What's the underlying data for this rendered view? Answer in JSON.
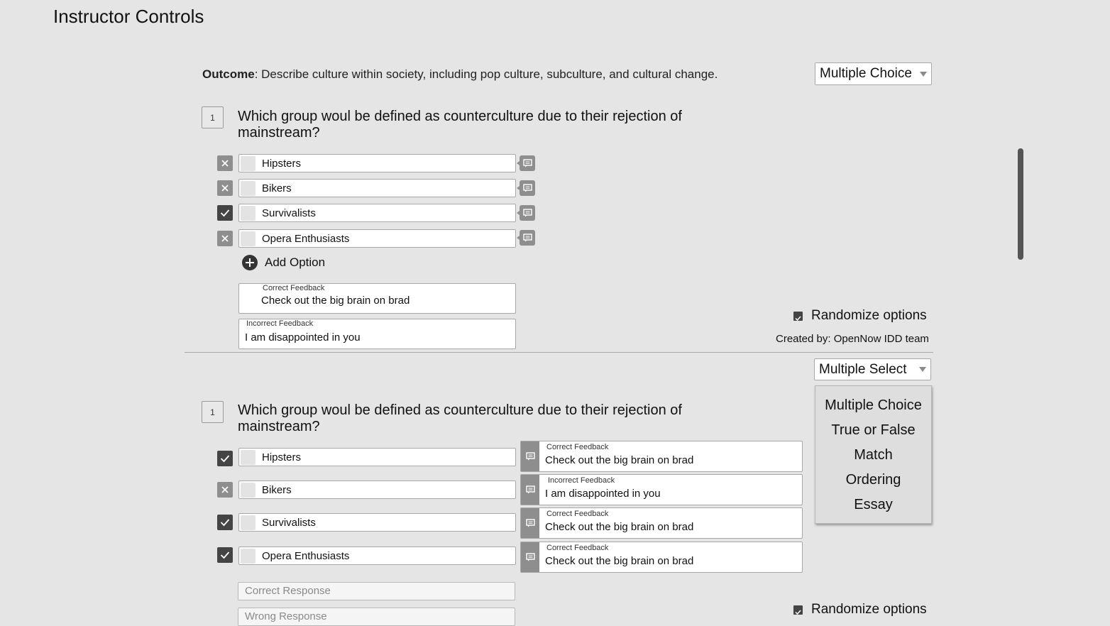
{
  "page": {
    "title": "Instructor Controls"
  },
  "outcome": {
    "label": "Outcome",
    "text": ": Describe culture within society, including pop culture, subculture, and cultural change."
  },
  "question1": {
    "type_select": "Multiple Choice",
    "number": "1",
    "text": "Which group woul be defined as counterculture due to their rejection of mainstream?",
    "options": [
      {
        "label": "Hipsters",
        "correct": false
      },
      {
        "label": "Bikers",
        "correct": false
      },
      {
        "label": "Survivalists",
        "correct": true
      },
      {
        "label": "Opera Enthusiasts",
        "correct": false
      }
    ],
    "add_option_label": "Add Option",
    "correct_feedback": {
      "label": "Correct Feedback",
      "value": "Check out the big brain on brad"
    },
    "incorrect_feedback": {
      "label": "Incorrect Feedback",
      "value": "I am disappointed in you"
    },
    "randomize_label": "Randomize options",
    "created_by": "Created by: OpenNow IDD team"
  },
  "question2": {
    "type_select": "Multiple Select",
    "type_options": [
      "Multiple Choice",
      "True or False",
      "Match",
      "Ordering",
      "Essay"
    ],
    "number": "1",
    "text": "Which group woul be defined as counterculture due to their rejection of mainstream?",
    "options": [
      {
        "label": "Hipsters",
        "correct": true,
        "feedback_label": "Correct Feedback",
        "feedback": "Check out the big brain on brad"
      },
      {
        "label": "Bikers",
        "correct": false,
        "feedback_label": "Incorrect Feedback",
        "feedback": "I am disappointed in you"
      },
      {
        "label": "Survivalists",
        "correct": true,
        "feedback_label": "Correct Feedback",
        "feedback": "Check out the big brain on brad"
      },
      {
        "label": "Opera Enthusiasts",
        "correct": true,
        "feedback_label": "Correct Feedback",
        "feedback": "Check out the big brain on brad"
      }
    ],
    "correct_response_placeholder": "Correct Response",
    "wrong_response_placeholder": "Wrong Response",
    "randomize_label": "Randomize options"
  },
  "icons": {
    "incorrect": "x-icon",
    "correct": "check-icon",
    "comment": "comment-icon",
    "add": "plus-circle-icon",
    "checkbox": "checkbox-checked-icon"
  }
}
